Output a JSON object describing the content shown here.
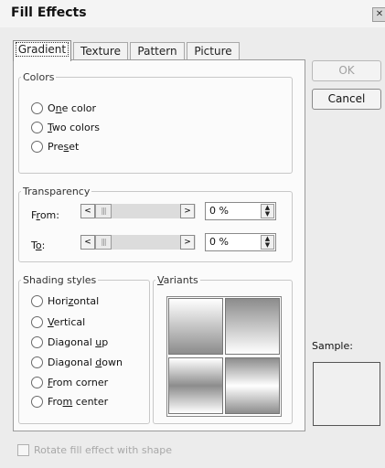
{
  "window": {
    "title": "Fill Effects",
    "close_label": "✕"
  },
  "tabs": [
    {
      "label": "Gradient",
      "active": true
    },
    {
      "label": "Texture",
      "active": false
    },
    {
      "label": "Pattern",
      "active": false
    },
    {
      "label": "Picture",
      "active": false
    }
  ],
  "colors": {
    "legend": "Colors",
    "options": [
      {
        "pre": "O",
        "key": "n",
        "post": "e color",
        "selected": false
      },
      {
        "pre": "",
        "key": "T",
        "post": "wo colors",
        "selected": false
      },
      {
        "pre": "Pre",
        "key": "s",
        "post": "et",
        "selected": false
      }
    ]
  },
  "transparency": {
    "legend": "Transparency",
    "from": {
      "pre": "F",
      "key": "r",
      "post": "om:",
      "value": "0 %"
    },
    "to": {
      "pre": "T",
      "key": "o",
      "post": ":",
      "value": "0 %"
    },
    "arrow_left": "<",
    "arrow_right": ">",
    "thumb_grip": "|||",
    "spin_up": "▲",
    "spin_down": "▼"
  },
  "shading": {
    "legend": "Shading styles",
    "options": [
      {
        "pre": "Hori",
        "key": "z",
        "post": "ontal",
        "selected": false
      },
      {
        "pre": "",
        "key": "V",
        "post": "ertical",
        "selected": false
      },
      {
        "pre": "Diagonal ",
        "key": "u",
        "post": "p",
        "selected": false
      },
      {
        "pre": "Diagonal ",
        "key": "d",
        "post": "own",
        "selected": false
      },
      {
        "pre": "",
        "key": "F",
        "post": "rom corner",
        "selected": false
      },
      {
        "pre": "Fro",
        "key": "m",
        "post": " center",
        "selected": false
      }
    ]
  },
  "variants": {
    "legend_pre": "",
    "legend_key": "V",
    "legend_post": "ariants",
    "swatch_colors": [
      "#ffffff",
      "#8c8c8c"
    ]
  },
  "buttons": {
    "ok": "OK",
    "cancel": "Cancel"
  },
  "sample": {
    "label": "Sample:"
  },
  "rotate": {
    "label": "Rotate fill effect with shape",
    "checked": false
  }
}
